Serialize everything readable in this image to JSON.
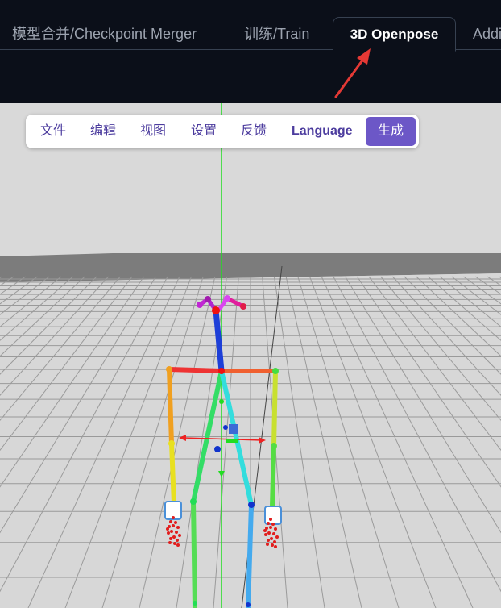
{
  "tabs": [
    {
      "label": "模型合并/Checkpoint Merger"
    },
    {
      "label": "训练/Train"
    },
    {
      "label": "3D Openpose",
      "active": true
    },
    {
      "label": "Addi"
    }
  ],
  "menu": {
    "items": [
      "文件",
      "编辑",
      "视图",
      "设置",
      "反馈"
    ],
    "language_label": "Language",
    "generate_label": "生成"
  },
  "colors": {
    "background": "#0b0f19",
    "accent": "#6c57c7",
    "annotation_arrow": "#e53935"
  },
  "icons": [
    "red-annotation-arrow",
    "pose-skeleton",
    "floor-grid",
    "vertical-axis-line"
  ]
}
